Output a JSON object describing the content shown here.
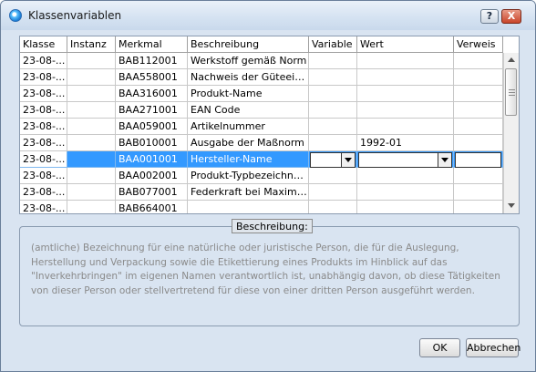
{
  "window": {
    "title": "Klassenvariablen",
    "help_label": "?",
    "close_label": "X"
  },
  "grid": {
    "columns": [
      "Klasse",
      "Instanz",
      "Merkmal",
      "Beschreibung",
      "Variable",
      "Wert",
      "Verweis"
    ],
    "rows": [
      [
        "23-08-...",
        "",
        "BAB112001",
        "Werkstoff gemäß Norm",
        "",
        "",
        ""
      ],
      [
        "23-08-...",
        "",
        "BAA558001",
        "Nachweis der Güteeige...",
        "",
        "",
        ""
      ],
      [
        "23-08-...",
        "",
        "BAA316001",
        "Produkt-Name",
        "",
        "",
        ""
      ],
      [
        "23-08-...",
        "",
        "BAA271001",
        "EAN Code",
        "",
        "",
        ""
      ],
      [
        "23-08-...",
        "",
        "BAA059001",
        "Artikelnummer",
        "",
        "",
        ""
      ],
      [
        "23-08-...",
        "",
        "BAB010001",
        "Ausgabe der Maßnorm",
        "",
        "1992-01",
        ""
      ],
      [
        "23-08-...",
        "",
        "BAA001001",
        "Hersteller-Name",
        "",
        "",
        ""
      ],
      [
        "23-08-...",
        "",
        "BAA002001",
        "Produkt-Typbezeichnung",
        "",
        "",
        ""
      ],
      [
        "23-08-...",
        "",
        "BAB077001",
        "Federkraft bei Maximallast",
        "",
        "",
        ""
      ],
      [
        "23-08-...",
        "",
        "BAB664001",
        "",
        "",
        "",
        ""
      ]
    ],
    "selected_row": 6,
    "variable_dropdown_value": "",
    "wert_dropdown_value": ""
  },
  "description": {
    "label": "Beschreibung:",
    "text": "(amtliche) Bezeichnung für eine natürliche oder juristische Person, die für die Auslegung, Herstellung und Verpackung sowie die Etikettierung eines Produkts im Hinblick auf das \"Inverkehrbringen\" im eigenen Namen verantwortlich ist, unabhängig davon, ob diese Tätigkeiten von dieser Person oder stellvertretend für diese von einer dritten Person ausgeführt werden."
  },
  "buttons": {
    "ok_label": "OK",
    "cancel_label": "Abbrechen"
  }
}
